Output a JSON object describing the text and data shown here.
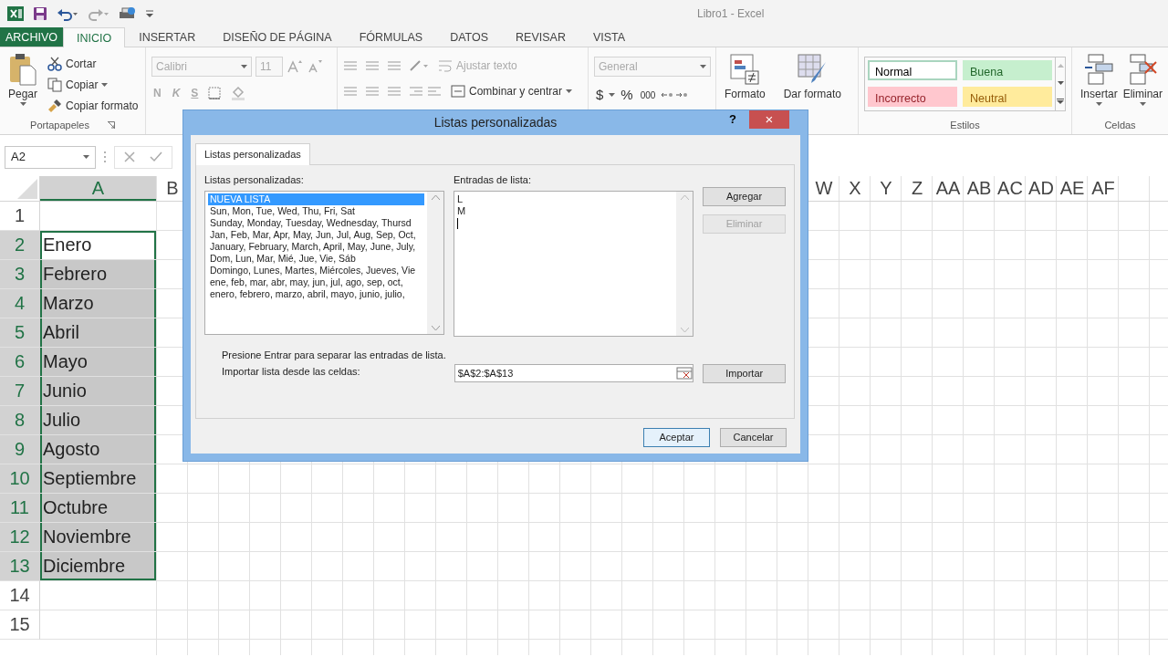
{
  "window": {
    "title": "Libro1 - Excel"
  },
  "ribbon_tabs": [
    {
      "label": "ARCHIVO",
      "kind": "file",
      "selected": false
    },
    {
      "label": "INICIO",
      "kind": "tab",
      "selected": true
    },
    {
      "label": "INSERTAR",
      "kind": "tab",
      "selected": false
    },
    {
      "label": "DISEÑO DE PÁGINA",
      "kind": "tab",
      "selected": false
    },
    {
      "label": "FÓRMULAS",
      "kind": "tab",
      "selected": false
    },
    {
      "label": "DATOS",
      "kind": "tab",
      "selected": false
    },
    {
      "label": "REVISAR",
      "kind": "tab",
      "selected": false
    },
    {
      "label": "VISTA",
      "kind": "tab",
      "selected": false
    }
  ],
  "clipboard": {
    "paste": "Pegar",
    "cut": "Cortar",
    "copy": "Copiar",
    "format_painter": "Copiar formato",
    "group_label": "Portapapeles"
  },
  "font": {
    "name": "Calibri",
    "size": "11",
    "bold": "N",
    "italic": "K",
    "underline": "S",
    "disabled": true
  },
  "alignment": {
    "wrap_text": "Ajustar texto",
    "wrap_disabled": true,
    "merge": "Combinar y centrar"
  },
  "number": {
    "format": "General",
    "disabled": true,
    "currency": "$",
    "percent": "%",
    "thousands": "000"
  },
  "format_buttons": [
    "Formato",
    "Dar formato"
  ],
  "styles": {
    "items": [
      {
        "label": "Normal",
        "color": "#ffffff",
        "selected": true
      },
      {
        "label": "Buena",
        "color": "#c6efce",
        "selected": false
      },
      {
        "label": "Incorrecto",
        "color": "#ffc7ce",
        "selected": false
      },
      {
        "label": "Neutral",
        "color": "#ffeb9c",
        "selected": false
      }
    ],
    "group_label": "Estilos"
  },
  "cells": {
    "buttons": [
      "Insertar",
      "Eliminar"
    ],
    "group_label": "Celdas"
  },
  "name_box": "A2",
  "columns": [
    {
      "label": "A",
      "selected": true
    },
    {
      "label": "B",
      "selected": false
    }
  ],
  "columns_right": [
    "W",
    "X",
    "Y",
    "Z",
    "AA",
    "AB",
    "AC",
    "AD",
    "AE",
    "AF"
  ],
  "rows": [
    {
      "number": "1",
      "selected": false,
      "active": false
    },
    {
      "number": "2",
      "value": "Enero",
      "selected": true,
      "active": true
    },
    {
      "number": "3",
      "value": "Febrero",
      "selected": true,
      "active": false
    },
    {
      "number": "4",
      "value": "Marzo",
      "selected": true,
      "active": false
    },
    {
      "number": "5",
      "value": "Abril",
      "selected": true,
      "active": false
    },
    {
      "number": "6",
      "value": "Mayo",
      "selected": true,
      "active": false
    },
    {
      "number": "7",
      "value": "Junio",
      "selected": true,
      "active": false
    },
    {
      "number": "8",
      "value": "Julio",
      "selected": true,
      "active": false
    },
    {
      "number": "9",
      "value": "Agosto",
      "selected": true,
      "active": false
    },
    {
      "number": "10",
      "value": "Septiembre",
      "selected": true,
      "active": false
    },
    {
      "number": "11",
      "value": "Octubre",
      "selected": true,
      "active": false
    },
    {
      "number": "12",
      "value": "Noviembre",
      "selected": true,
      "active": false
    },
    {
      "number": "13",
      "value": "Diciembre",
      "selected": true,
      "active": false
    },
    {
      "number": "14",
      "selected": false,
      "active": false
    },
    {
      "number": "15",
      "selected": false,
      "active": false
    }
  ],
  "dialog": {
    "title": "Listas personalizadas",
    "help": "?",
    "close": "×",
    "tab": "Listas personalizadas",
    "lists_label": "Listas personalizadas:",
    "lists": [
      {
        "text": "NUEVA LISTA",
        "selected": true
      },
      {
        "text": "Sun, Mon, Tue, Wed, Thu, Fri, Sat",
        "selected": false
      },
      {
        "text": "Sunday, Monday, Tuesday, Wednesday, Thursd",
        "selected": false
      },
      {
        "text": "Jan, Feb, Mar, Apr, May, Jun, Jul, Aug, Sep, Oct,",
        "selected": false
      },
      {
        "text": "January, February, March, April, May, June, July,",
        "selected": false
      },
      {
        "text": "Dom, Lun, Mar, Mié, Jue, Vie, Sáb",
        "selected": false
      },
      {
        "text": "Domingo, Lunes, Martes, Miércoles, Jueves, Vie",
        "selected": false
      },
      {
        "text": "ene, feb, mar, abr, may, jun, jul, ago, sep, oct,",
        "selected": false
      },
      {
        "text": "enero, febrero, marzo, abril, mayo, junio, julio,",
        "selected": false
      }
    ],
    "entries_label": "Entradas de lista:",
    "entries": [
      "L",
      "M"
    ],
    "side_buttons": [
      {
        "label": "Agregar",
        "disabled": false
      },
      {
        "label": "Eliminar",
        "disabled": true
      }
    ],
    "hint": "Presione Entrar para separar las entradas de lista.",
    "import_label": "Importar lista desde las celdas:",
    "import_range": "$A$2:$A$13",
    "import_button": "Importar",
    "ok": "Aceptar",
    "cancel": "Cancelar"
  }
}
